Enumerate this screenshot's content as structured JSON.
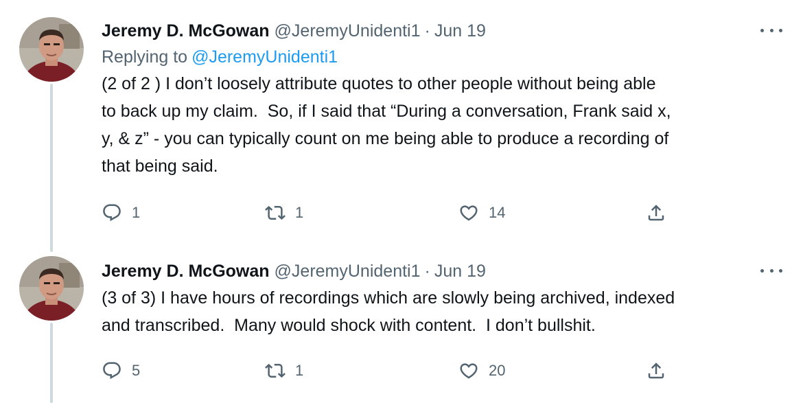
{
  "tweets": [
    {
      "author_name": "Jeremy D. McGowan",
      "handle": "@JeremyUnidenti1",
      "separator": "·",
      "date": "Jun 19",
      "replying_to_label": "Replying to",
      "replying_to_handle": "@JeremyUnidenti1",
      "text": "(2 of 2 ) I don’t loosely attribute quotes to other people without being able\nto back up my claim.  So, if I said that “During a conversation, Frank said x,\ny, & z” - you can typically count on me being able to produce a recording of\nthat being said.",
      "reply_count": "1",
      "retweet_count": "1",
      "like_count": "14"
    },
    {
      "author_name": "Jeremy D. McGowan",
      "handle": "@JeremyUnidenti1",
      "separator": "·",
      "date": "Jun 19",
      "text": "(3 of 3) I have hours of recordings which are slowly being archived, indexed\nand transcribed.  Many would shock with content.  I don’t bullshit.",
      "reply_count": "5",
      "retweet_count": "1",
      "like_count": "20"
    }
  ],
  "icons": {
    "reply": "reply-icon",
    "retweet": "retweet-icon",
    "like": "heart-icon",
    "share": "share-icon",
    "more": "more-icon"
  },
  "colors": {
    "text": "#0f1419",
    "secondary": "#536471",
    "link": "#1d9bf0",
    "thread_line": "#cfd9de"
  }
}
